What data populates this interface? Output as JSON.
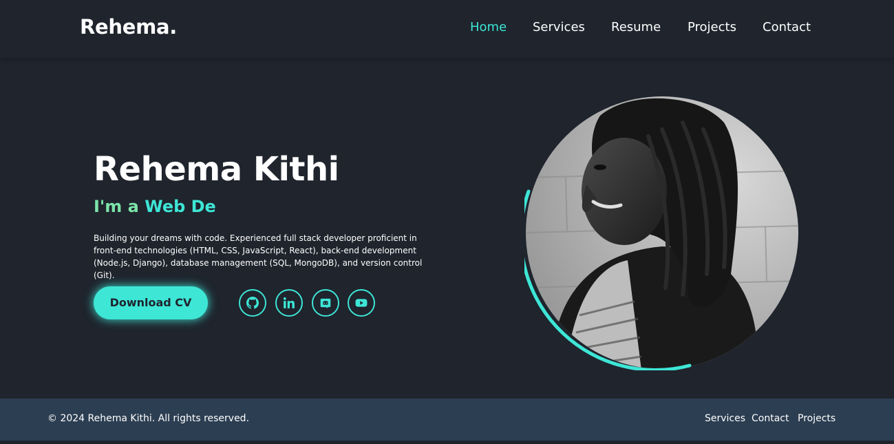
{
  "header": {
    "logo": "Rehema.",
    "nav": [
      {
        "label": "Home",
        "active": true
      },
      {
        "label": "Services",
        "active": false
      },
      {
        "label": "Resume",
        "active": false
      },
      {
        "label": "Projects",
        "active": false
      },
      {
        "label": "Contact",
        "active": false
      }
    ]
  },
  "hero": {
    "name": "Rehema Kithi",
    "subtitle_lead": "I'm a ",
    "subtitle_typed": "Web De",
    "description": "Building your dreams with code. Experienced full stack developer proficient in front-end technologies (HTML, CSS, JavaScript, React), back-end development (Node.js, Django), database management (SQL, MongoDB), and version control (Git).",
    "download_label": "Download CV",
    "socials": [
      {
        "icon": "github-icon"
      },
      {
        "icon": "linkedin-icon"
      },
      {
        "icon": "discord-icon"
      },
      {
        "icon": "youtube-icon"
      }
    ]
  },
  "footer": {
    "copyright": "© 2024 Rehema Kithi. All rights reserved.",
    "links": [
      "Services",
      "Contact",
      "Projects"
    ]
  },
  "colors": {
    "background": "#1f242d",
    "accent": "#3ee6d6",
    "subtitle_lead": "#7de3a8",
    "footer_bg": "#2c3e52"
  }
}
